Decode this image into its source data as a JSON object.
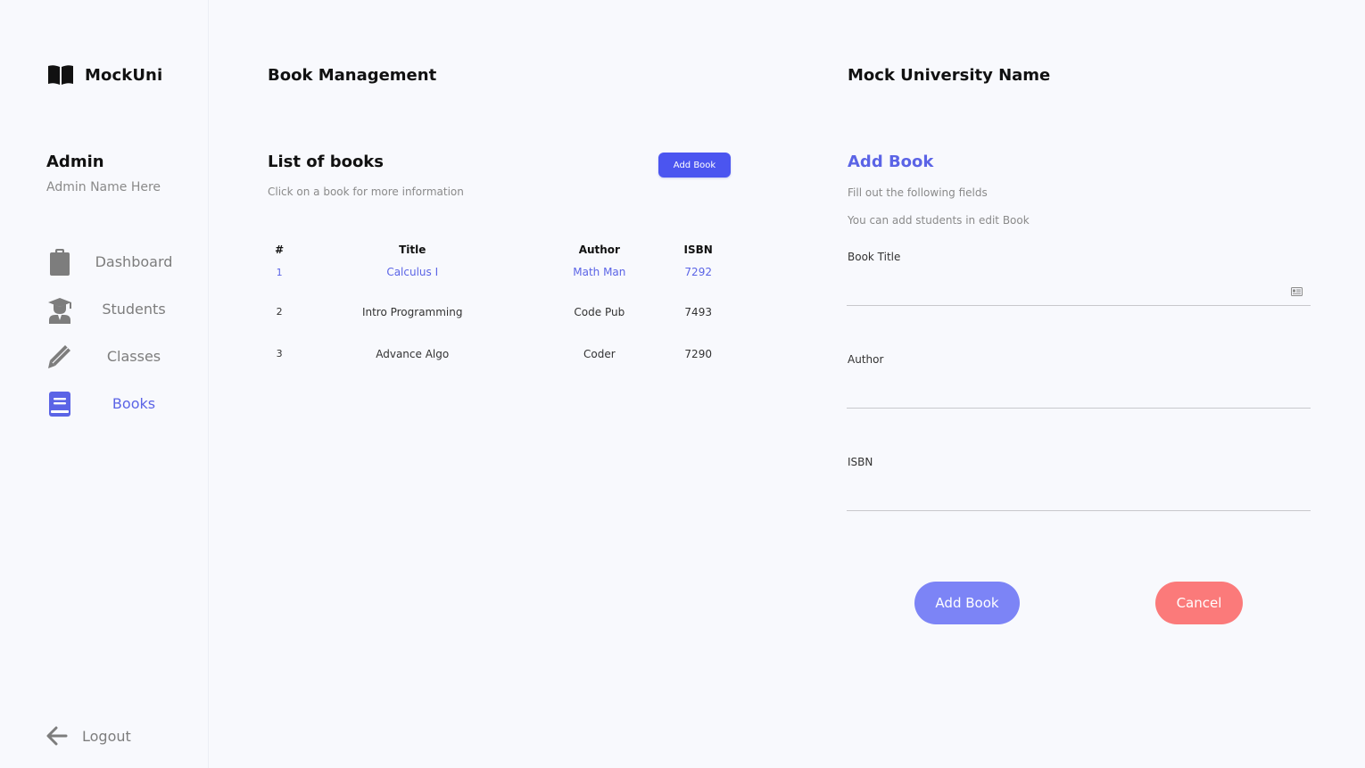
{
  "brand": {
    "name": "MockUni",
    "icon": "open-book-icon"
  },
  "user": {
    "role": "Admin",
    "name": "Admin Name Here"
  },
  "nav": {
    "items": [
      {
        "label": "Dashboard",
        "icon": "clipboard-icon",
        "active": false
      },
      {
        "label": "Students",
        "icon": "graduate-icon",
        "active": false
      },
      {
        "label": "Classes",
        "icon": "pencil-icon",
        "active": false
      },
      {
        "label": "Books",
        "icon": "book-icon",
        "active": true
      }
    ],
    "logout": {
      "label": "Logout",
      "icon": "arrow-left-icon"
    }
  },
  "page": {
    "title": "Book Management",
    "university": "Mock University Name"
  },
  "books": {
    "title": "List of books",
    "subtitle": "Click on a book for more information",
    "add_button": "Add Book",
    "columns": [
      "#",
      "Title",
      "Author",
      "ISBN"
    ],
    "rows": [
      {
        "num": "1",
        "title": "Calculus I",
        "author": "Math Man",
        "isbn": "7292",
        "highlighted": true
      },
      {
        "num": "2",
        "title": "Intro Programming",
        "author": "Code Pub",
        "isbn": "7493",
        "highlighted": false
      },
      {
        "num": "3",
        "title": "Advance Algo",
        "author": "Coder",
        "isbn": "7290",
        "highlighted": false
      }
    ]
  },
  "form": {
    "title": "Add Book",
    "subtitle1": "Fill out the following fields",
    "subtitle2": "You can add students in edit Book",
    "fields": [
      {
        "label": "Book Title",
        "value": ""
      },
      {
        "label": "Author",
        "value": ""
      },
      {
        "label": "ISBN",
        "value": ""
      }
    ],
    "submit": "Add Book",
    "cancel": "Cancel"
  },
  "colors": {
    "accent": "#5b64e6",
    "button_primary": "#4b55f0",
    "button_submit": "#7c84f6",
    "button_cancel": "#fb7a7a",
    "icon_gray": "#7d7d7d"
  }
}
